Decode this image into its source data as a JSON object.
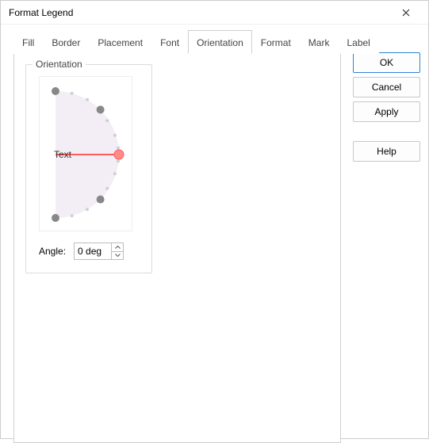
{
  "window": {
    "title": "Format Legend"
  },
  "tabs": {
    "t0": "Fill",
    "t1": "Border",
    "t2": "Placement",
    "t3": "Font",
    "t4": "Orientation",
    "t5": "Format",
    "t6": "Mark",
    "t7": "Label",
    "active": "Orientation"
  },
  "buttons": {
    "ok": "OK",
    "cancel": "Cancel",
    "apply": "Apply",
    "help": "Help"
  },
  "orientation": {
    "group_label": "Orientation",
    "dial_text": "Text",
    "angle_label": "Angle:",
    "angle_value": "0 deg"
  },
  "colors": {
    "accent": "#2e83d8",
    "needle": "#ff5c5c",
    "dot_major": "#888888",
    "dot_minor": "#cfcfcf",
    "arc_fill": "#f3eef6"
  }
}
